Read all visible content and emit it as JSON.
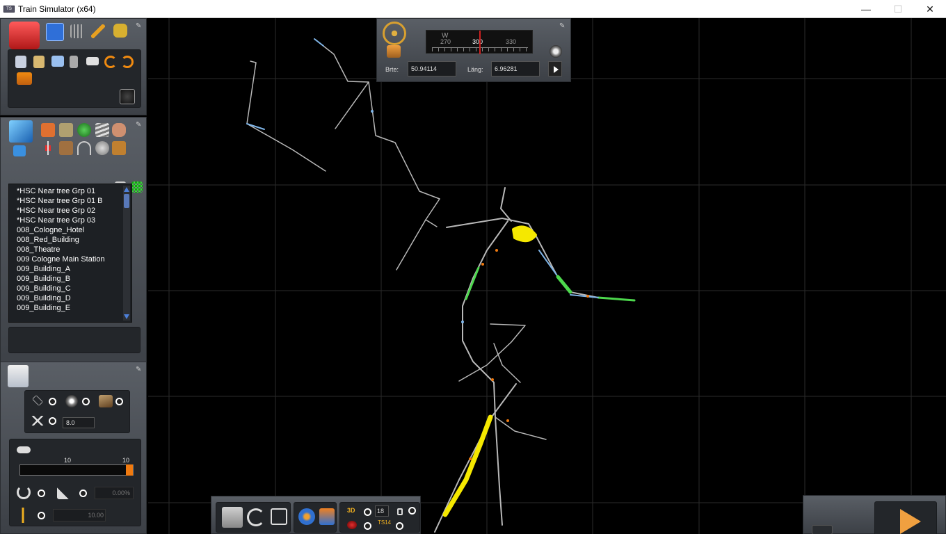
{
  "window": {
    "title": "Train Simulator (x64)",
    "app_icon": "TS",
    "minimize": "—",
    "maximize": "☐",
    "close": "✕"
  },
  "compass": {
    "ticks": [
      "W",
      "270",
      "300",
      "330"
    ],
    "lat_label": "Brte:",
    "lat_value": "50.94114",
    "lon_label": "Läng:",
    "lon_value": "6.96281"
  },
  "object_list": {
    "items": [
      "*HSC Near tree Grp 01",
      "*HSC Near tree Grp 01 B",
      "*HSC Near tree Grp 02",
      "*HSC Near tree Grp 03",
      "008_Cologne_Hotel",
      "008_Red_Building",
      "008_Theatre",
      "009 Cologne Main Station",
      "009_Building_A",
      "009_Building_B",
      "009_Building_C",
      "009_Building_D",
      "009_Building_E"
    ]
  },
  "tool_options": {
    "spacing_value": "8.0",
    "scale_min": "10",
    "scale_max": "10",
    "rotate_value": "0.00%",
    "height_value": "10.00"
  },
  "bottom_bar": {
    "counter_value": "18",
    "label_3d": "3D",
    "label_ts": "TS14"
  },
  "colors": {
    "panel": "#4a4f56",
    "accent_orange": "#f07a10",
    "track": "#b8b8b8",
    "track_blue": "#7fb5e8",
    "track_green": "#4dd84d",
    "track_yellow": "#f5e800",
    "grid": "#2a2a2a"
  }
}
